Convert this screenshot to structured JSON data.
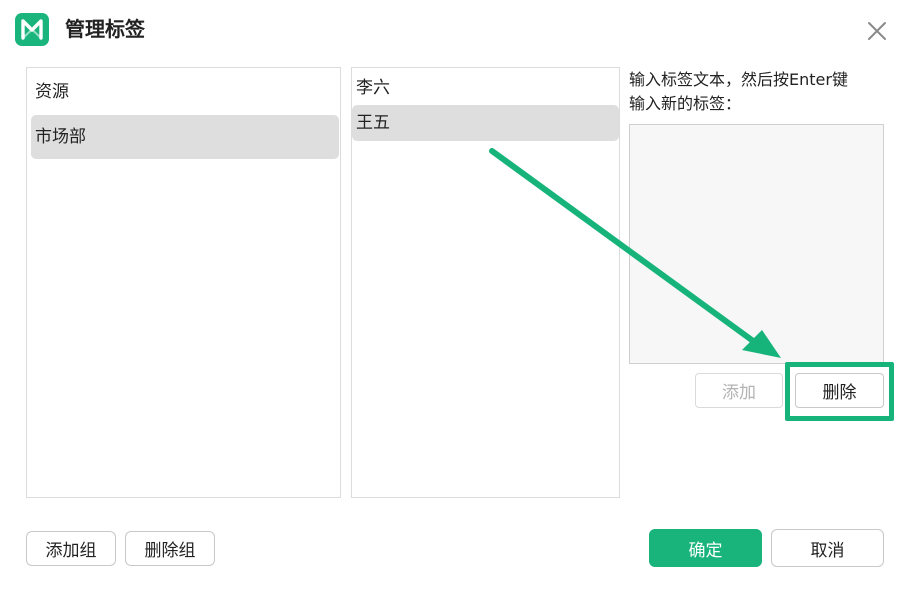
{
  "dialog": {
    "title": "管理标签",
    "logo_icon": "mindmaster-logo-icon",
    "close_icon": "close-icon",
    "accent_color": "#19b37c"
  },
  "groups_panel": {
    "items": [
      {
        "label": "资源",
        "selected": false
      },
      {
        "label": "市场部",
        "selected": true
      }
    ]
  },
  "tags_panel": {
    "items": [
      {
        "label": "李六",
        "selected": false
      },
      {
        "label": "王五",
        "selected": true
      }
    ]
  },
  "input_panel": {
    "hint_line1": "输入标签文本，然后按Enter键",
    "hint_line2": "输入新的标签：",
    "text_value": ""
  },
  "buttons": {
    "add": "添加",
    "delete": "删除",
    "add_group": "添加组",
    "delete_group": "删除组",
    "ok": "确定",
    "cancel": "取消"
  },
  "annotation": {
    "arrow_color": "#16b47a"
  }
}
